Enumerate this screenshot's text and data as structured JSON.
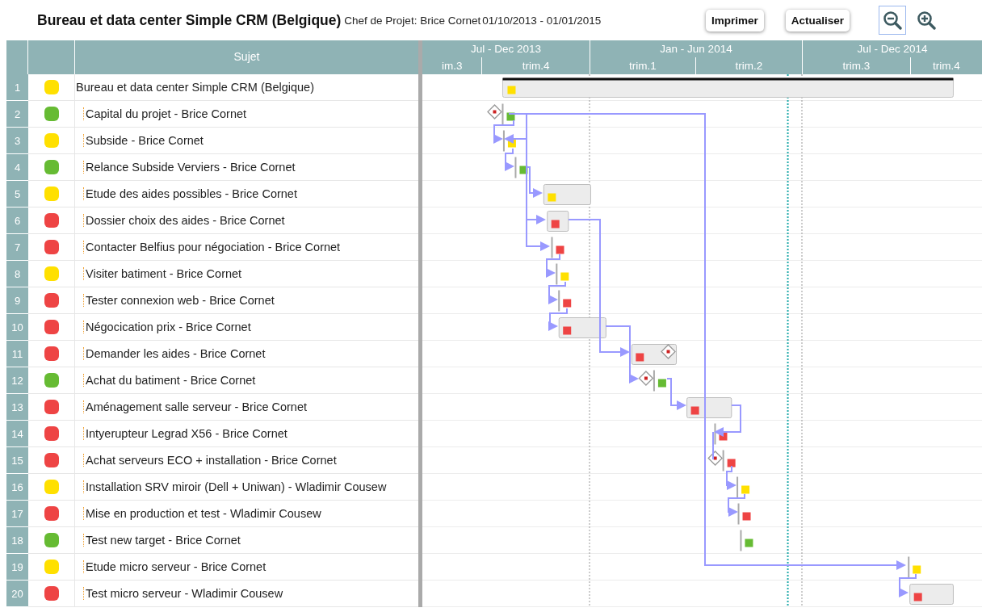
{
  "header": {
    "title": "Bureau et data center Simple CRM (Belgique)",
    "manager": "Chef de Projet: Brice Cornet",
    "period": "01/10/2013 - 01/01/2015",
    "buttons": [
      "Imprimer",
      "Actualiser"
    ],
    "zoom": [
      {
        "kind": "zoom-out",
        "selected": true
      },
      {
        "kind": "zoom-in",
        "selected": false
      }
    ]
  },
  "grid": {
    "subject_header": "Sujet"
  },
  "timeline": {
    "periods": [
      "Jul - Dec 2013",
      "Jan - Jun 2014",
      "Jul - Dec 2014"
    ],
    "quarters": [
      "im.3",
      "trim.4",
      "trim.1",
      "trim.2",
      "trim.3",
      "trim.4"
    ]
  },
  "tasks": [
    {
      "num": "1",
      "subject": "Bureau et data center Simple CRM (Belgique)",
      "color": "#ffe000",
      "kind": "summary",
      "children": [
        {
          "num": "2",
          "subject": "Capital du projet - Brice Cornet",
          "color": "#66bb33",
          "kind": "point"
        },
        {
          "num": "3",
          "subject": "Subside - Brice Cornet",
          "color": "#ffe000",
          "kind": "point"
        },
        {
          "num": "4",
          "subject": "Relance Subside Verviers - Brice Cornet",
          "color": "#66bb33",
          "kind": "point"
        },
        {
          "num": "5",
          "subject": "Etude des aides possibles - Brice Cornet",
          "color": "#ffe000",
          "kind": "bar"
        },
        {
          "num": "6",
          "subject": "Dossier choix des aides - Brice Cornet",
          "color": "#ee4444",
          "kind": "bar"
        },
        {
          "num": "7",
          "subject": "Contacter Belfius pour négociation - Brice Cornet",
          "color": "#ee4444",
          "kind": "point"
        },
        {
          "num": "8",
          "subject": "Visiter batiment - Brice Cornet",
          "color": "#ffe000",
          "kind": "point"
        },
        {
          "num": "9",
          "subject": "Tester connexion web - Brice Cornet",
          "color": "#ee4444",
          "kind": "point"
        },
        {
          "num": "10",
          "subject": "Négocication prix - Brice Cornet",
          "color": "#ee4444",
          "kind": "bar"
        },
        {
          "num": "11",
          "subject": "Demander les aides - Brice Cornet",
          "color": "#ee4444",
          "kind": "bar"
        },
        {
          "num": "12",
          "subject": "Achat du batiment - Brice Cornet",
          "color": "#66bb33",
          "kind": "point"
        },
        {
          "num": "13",
          "subject": "Aménagement salle serveur - Brice Cornet",
          "color": "#ee4444",
          "kind": "bar"
        },
        {
          "num": "14",
          "subject": "Intyerupteur Legrad X56 - Brice Cornet",
          "color": "#ee4444",
          "kind": "point"
        },
        {
          "num": "15",
          "subject": "Achat serveurs ECO + installation - Brice Cornet",
          "color": "#ee4444",
          "kind": "point"
        },
        {
          "num": "16",
          "subject": "Installation SRV miroir (Dell + Uniwan) - Wladimir Cousew",
          "color": "#ffe000",
          "kind": "point"
        },
        {
          "num": "17",
          "subject": "Mise en production et test - Wladimir Cousew",
          "color": "#ee4444",
          "kind": "point"
        },
        {
          "num": "18",
          "subject": "Test new target - Brice Cornet",
          "color": "#66bb33",
          "kind": "point"
        },
        {
          "num": "19",
          "subject": "Etude micro serveur - Brice Cornet",
          "color": "#ffe000",
          "kind": "point"
        },
        {
          "num": "20",
          "subject": "Test micro serveur - Wladimir Cousew",
          "color": "#ee4444",
          "kind": "bar"
        }
      ]
    }
  ]
}
